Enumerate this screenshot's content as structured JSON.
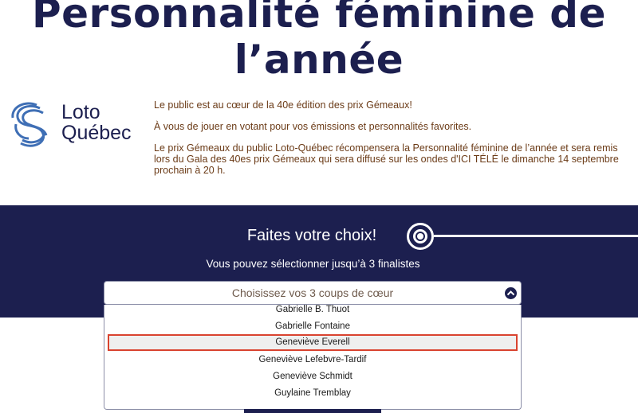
{
  "hero": {
    "title_line1": "Personnalité féminine de",
    "title_line2": "l’année"
  },
  "logo": {
    "line1": "Loto",
    "line2": "Québec"
  },
  "intro": {
    "p1": "Le public est au cœur de la 40e édition des prix Gémeaux!",
    "p2": "À vous de jouer en votant pour vos émissions et personnalités favorites.",
    "p3": "Le prix Gémeaux du public Loto-Québec récompensera la Personnalité féminine de l’année et sera remis lors du Gala des 40es prix Gémeaux qui sera diffusé sur les ondes d'ICI TÉLÉ le dimanche 14 septembre prochain à 20 h."
  },
  "vote": {
    "title": "Faites votre choix!",
    "subtitle": "Vous pouvez sélectionner jusqu’à 3 finalistes",
    "select_placeholder": "Choisissez vos 3 coups de cœur",
    "options": [
      "Gabrielle B. Thuot",
      "Gabrielle Fontaine",
      "Geneviève Everell",
      "Geneviève Lefebvre-Tardif",
      "Geneviève Schmidt",
      "Guylaine Tremblay"
    ],
    "highlighted_option": "Geneviève Everell"
  },
  "colors": {
    "navy": "#1c1f4f",
    "body_text": "#6b3b17",
    "highlight_border": "#d9432f"
  }
}
